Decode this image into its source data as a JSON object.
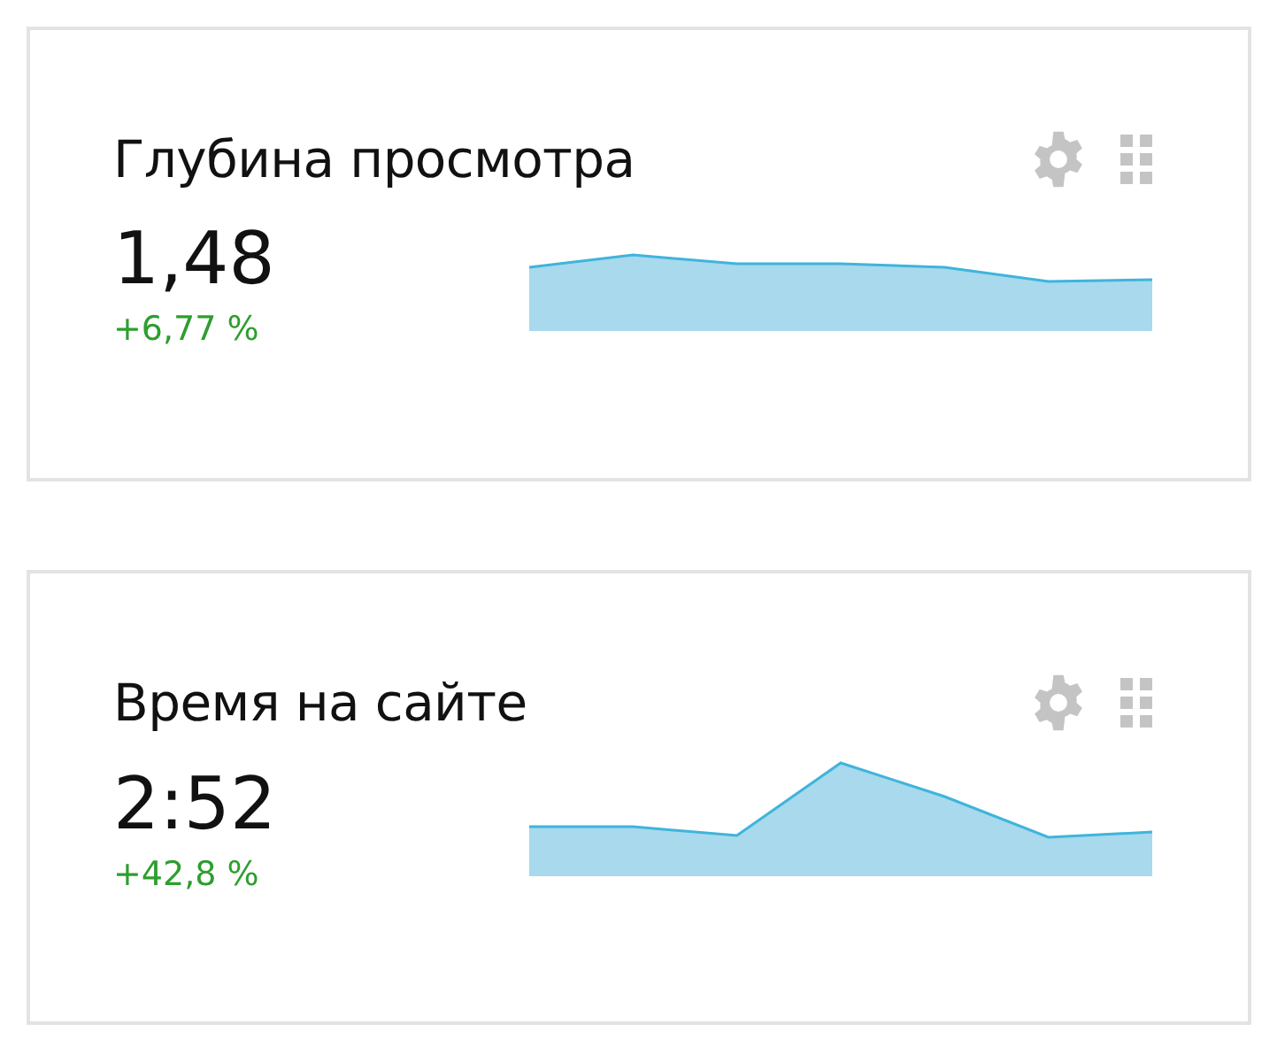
{
  "widgets": [
    {
      "title": "Глубина просмотра",
      "value": "1,48",
      "change": "+6,77 %"
    },
    {
      "title": "Время на сайте",
      "value": "2:52",
      "change": "+42,8 %"
    }
  ]
}
